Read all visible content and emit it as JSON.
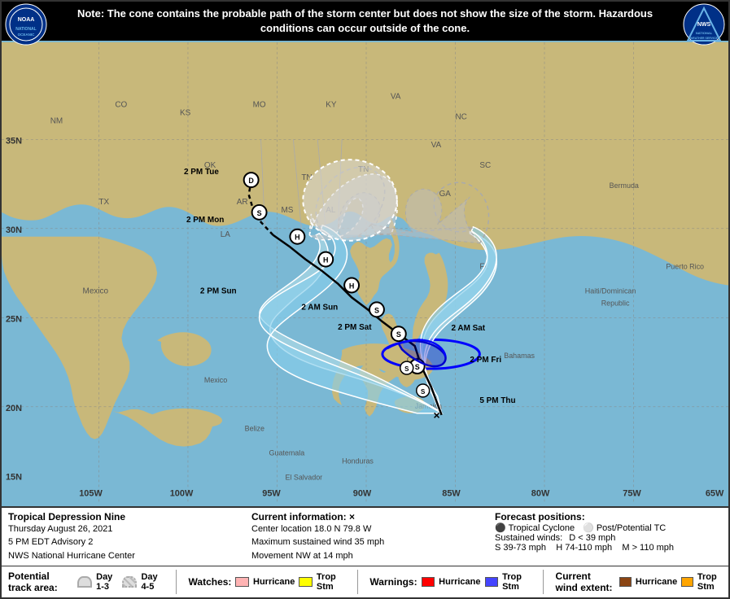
{
  "notice": {
    "text": "Note: The cone contains the probable path of the storm center but does not show the size of the storm. Hazardous conditions can occur outside of the cone."
  },
  "storm": {
    "name": "Tropical Depression Nine",
    "date": "Thursday August 26, 2021",
    "advisory": "5 PM EDT Advisory 2",
    "center": "NWS National Hurricane Center"
  },
  "current_info": {
    "title": "Current information:",
    "location": "Center location 18.0 N 79.8 W",
    "wind": "Maximum sustained wind 35 mph",
    "movement": "Movement NW at 14 mph"
  },
  "forecast": {
    "title": "Forecast positions:",
    "tc_label": "Tropical Cyclone",
    "post_label": "Post/Potential TC",
    "winds_label": "Sustained winds:",
    "d_range": "D < 39 mph",
    "s_range": "S 39-73 mph",
    "h_range": "H 74-110 mph",
    "m_range": "M > 110 mph"
  },
  "legend": {
    "track_title": "Potential track area:",
    "day13": "Day 1-3",
    "day45": "Day 4-5",
    "watches_title": "Watches:",
    "watch_hurricane": "Hurricane",
    "watch_trop": "Trop Stm",
    "warnings_title": "Warnings:",
    "warn_hurricane": "Hurricane",
    "warn_trop": "Trop Stm",
    "wind_title": "Current wind extent:",
    "wind_hurricane": "Hurricane",
    "wind_trop": "Trop Stm"
  },
  "forecast_times": [
    {
      "label": "5 PM Thu",
      "symbol": "X"
    },
    {
      "label": "2 PM Fri",
      "symbol": "S"
    },
    {
      "label": "2 AM Sat",
      "symbol": "S"
    },
    {
      "label": "2 PM Sat",
      "symbol": "S"
    },
    {
      "label": "2 AM Sun",
      "symbol": "H"
    },
    {
      "label": "2 PM Sun",
      "symbol": "H"
    },
    {
      "label": "2 PM Mon",
      "symbol": "S"
    },
    {
      "label": "2 PM Tue",
      "symbol": "D"
    }
  ]
}
